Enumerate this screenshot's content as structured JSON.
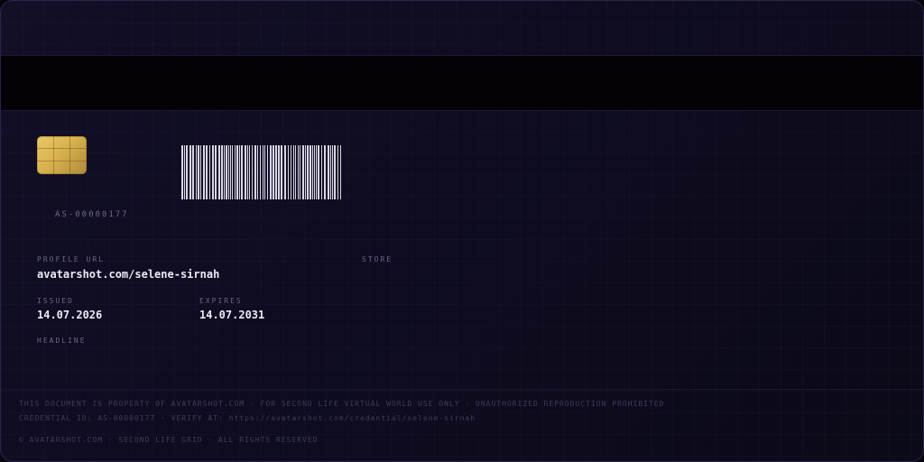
{
  "card": {
    "credential_number": "AS-00000177",
    "fields": {
      "profile_url_label": "PROFILE URL",
      "profile_url_value": "avatarshot.com/selene-sirnah",
      "store_label": "STORE",
      "issued_label": "ISSUED",
      "issued_value": "14.07.2026",
      "expires_label": "EXPIRES",
      "expires_value": "14.07.2031",
      "headline_label": "HEADLINE"
    },
    "footer": {
      "line1": "THIS DOCUMENT IS PROPERTY OF AVATARSHOT.COM · FOR SECOND LIFE VIRTUAL WORLD USE ONLY · UNAUTHORIZED REPRODUCTION PROHIBITED",
      "line2": "CREDENTIAL ID: AS-00000177 · VERIFY AT: https://avatarshot.com/credential/selene-sirnah",
      "line3": "© AVATARSHOT.COM · SECOND LIFE GRID · ALL RIGHTS RESERVED"
    }
  },
  "colors": {
    "background": "#0f0c20",
    "stripe": "#040207",
    "chip_gold": "#d9b24f",
    "barcode": "#d8d6e6",
    "label": "#6a6688",
    "value": "#ebe9f6"
  },
  "icons": {
    "chip": "smartcard-chip-icon",
    "barcode": "barcode-icon"
  }
}
